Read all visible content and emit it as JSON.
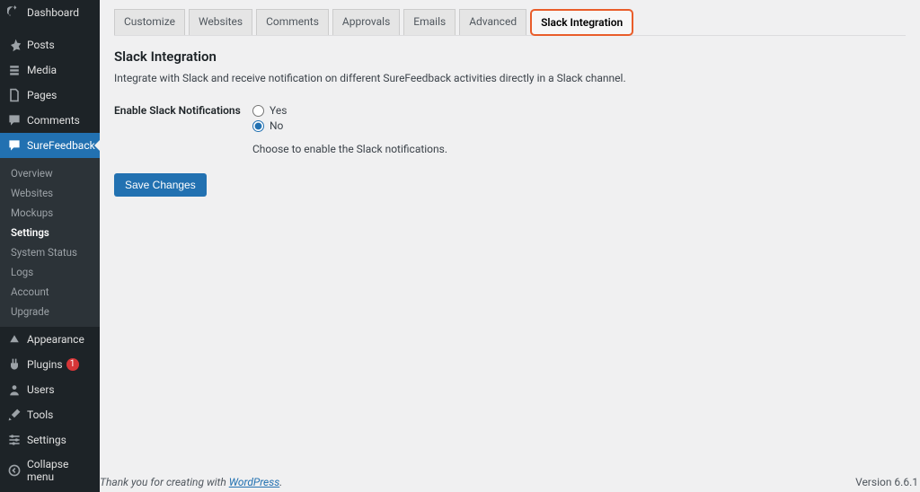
{
  "sidebar": {
    "items": [
      {
        "label": "Dashboard",
        "icon": "dashboard-icon"
      },
      {
        "label": "Posts",
        "icon": "pin-icon"
      },
      {
        "label": "Media",
        "icon": "media-icon"
      },
      {
        "label": "Pages",
        "icon": "pages-icon"
      },
      {
        "label": "Comments",
        "icon": "comments-icon"
      },
      {
        "label": "SureFeedback",
        "icon": "feedback-icon",
        "current": true
      },
      {
        "label": "Appearance",
        "icon": "appearance-icon"
      },
      {
        "label": "Plugins",
        "icon": "plugins-icon",
        "badge": "1"
      },
      {
        "label": "Users",
        "icon": "users-icon"
      },
      {
        "label": "Tools",
        "icon": "tools-icon"
      },
      {
        "label": "Settings",
        "icon": "settings-icon"
      },
      {
        "label": "Collapse menu",
        "icon": "collapse-icon"
      }
    ],
    "submenu": [
      "Overview",
      "Websites",
      "Mockups",
      "Settings",
      "System Status",
      "Logs",
      "Account",
      "Upgrade"
    ],
    "submenu_current": "Settings"
  },
  "tabs": [
    "Customize",
    "Websites",
    "Comments",
    "Approvals",
    "Emails",
    "Advanced",
    "Slack Integration"
  ],
  "tabs_active": "Slack Integration",
  "page": {
    "title": "Slack Integration",
    "intro": "Integrate with Slack and receive notification on different SureFeedback activities directly in a Slack channel.",
    "label_enable": "Enable Slack Notifications",
    "radio_yes": "Yes",
    "radio_no": "No",
    "radio_selected": "No",
    "help": "Choose to enable the Slack notifications.",
    "save_label": "Save Changes"
  },
  "footer": {
    "text_prefix": "Thank you for creating with ",
    "link_label": "WordPress",
    "text_suffix": ".",
    "version_label": "Version 6.6.1"
  }
}
